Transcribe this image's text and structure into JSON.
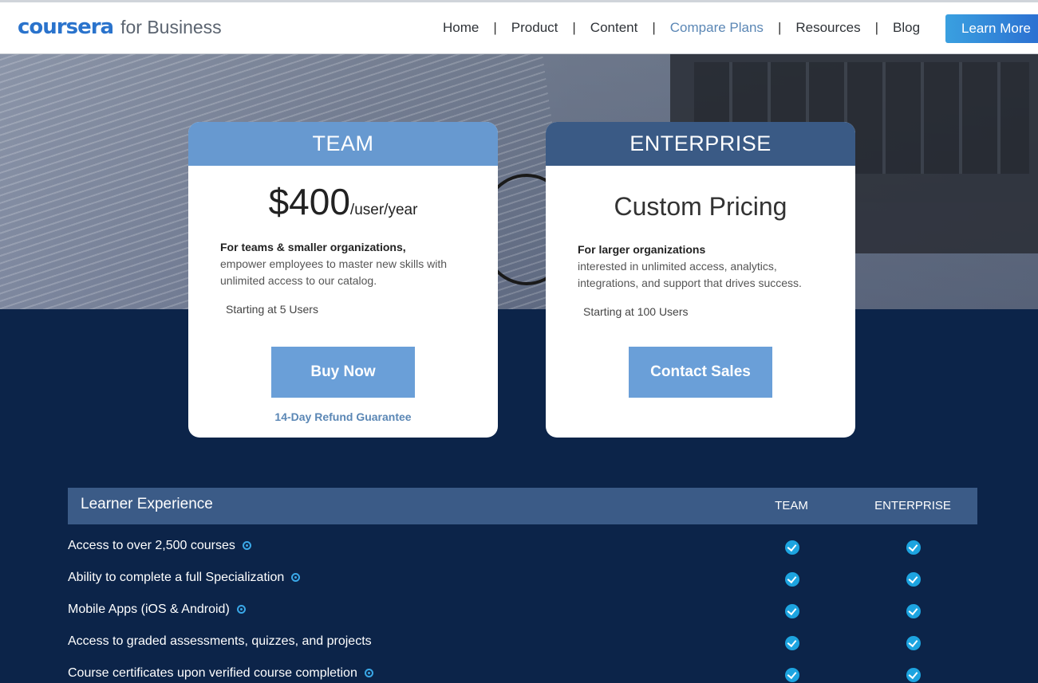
{
  "header": {
    "logo": "coursera",
    "logo_suffix": "for Business",
    "nav": [
      {
        "label": "Home"
      },
      {
        "label": "Product"
      },
      {
        "label": "Content"
      },
      {
        "label": "Compare Plans",
        "active": true
      },
      {
        "label": "Resources"
      },
      {
        "label": "Blog"
      }
    ],
    "learn_more": "Learn More"
  },
  "plans": {
    "team": {
      "title": "TEAM",
      "price": "$400",
      "price_unit": "/user/year",
      "desc_strong": "For teams & smaller organizations,",
      "desc": "empower employees to master new skills with unlimited access to our catalog.",
      "starting": "Starting at 5 Users",
      "cta": "Buy Now",
      "refund": "14-Day Refund Guarantee"
    },
    "enterprise": {
      "title": "ENTERPRISE",
      "price": "Custom Pricing",
      "desc_strong": "For larger organizations",
      "desc": "interested in unlimited access, analytics, integrations, and support that drives success.",
      "starting": "Starting at 100 Users",
      "cta": "Contact Sales"
    }
  },
  "features": {
    "section_title": "Learner Experience",
    "col_team": "TEAM",
    "col_enterprise": "ENTERPRISE",
    "rows": [
      {
        "label": "Access to over 2,500 courses",
        "info": true,
        "team": true,
        "enterprise": true
      },
      {
        "label": "Ability to complete a full Specialization",
        "info": true,
        "team": true,
        "enterprise": true
      },
      {
        "label": "Mobile Apps (iOS & Android)",
        "info": true,
        "team": true,
        "enterprise": true
      },
      {
        "label": "Access to graded assessments, quizzes, and projects",
        "info": false,
        "team": true,
        "enterprise": true
      },
      {
        "label": "Course certificates upon verified course completion",
        "info": true,
        "team": true,
        "enterprise": true
      }
    ]
  },
  "colors": {
    "brand_blue": "#2a73cc",
    "team_header": "#6799d0",
    "enterprise_header": "#3a5a85",
    "page_bg": "#0c2449",
    "check": "#1da4e0"
  }
}
